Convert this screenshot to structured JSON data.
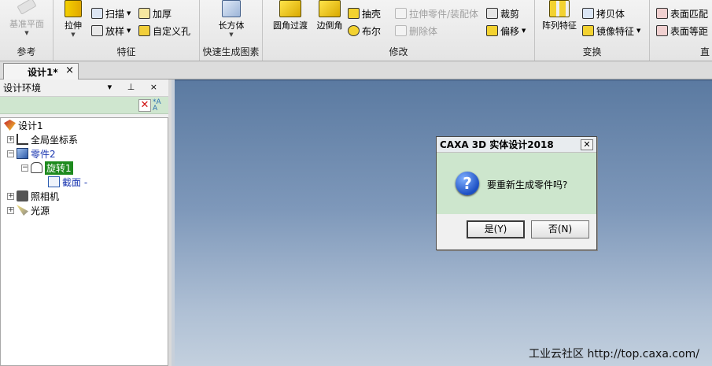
{
  "ribbon": {
    "groups": {
      "reference": "参考",
      "feature": "特征",
      "quick_gen": "快速生成图素",
      "modify": "修改",
      "transform": "变换",
      "cut_off": "直"
    },
    "buttons": {
      "reference_plane": "基准平面",
      "extrude": "拉伸",
      "sweep": "扫描",
      "loft": "放样",
      "thicken": "加厚",
      "custom_hole": "自定义孔",
      "box": "长方体",
      "fillet": "圆角过渡",
      "chamfer": "边倒角",
      "shell": "抽壳",
      "boolean": "布尔",
      "stretch_part": "拉伸零件/装配体",
      "delete_body": "删除体",
      "trim": "裁剪",
      "offset": "偏移",
      "array": "阵列特征",
      "copy": "拷贝体",
      "mirror": "镜像特征",
      "surface_match": "表面匹配",
      "surface_equal": "表面等距"
    }
  },
  "tabs": {
    "document": "设计1*",
    "close": "×"
  },
  "panel": {
    "title": "设计环境",
    "header_buttons": "▾ ⊥ ×",
    "tree": {
      "root": "设计1",
      "global_coords": "全局坐标系",
      "part": "零件2",
      "revolve": "旋转1",
      "section": "截面 -",
      "camera": "照相机",
      "light": "光源"
    }
  },
  "dialog": {
    "title": "CAXA 3D 实体设计2018",
    "message": "要重新生成零件吗?",
    "yes": "是(Y)",
    "no": "否(N)"
  },
  "viewport": {
    "watermark": "工业云社区 http://top.caxa.com/"
  },
  "colors": {
    "viewport_top": "#5b7aa1",
    "viewport_bottom": "#c3d0de",
    "panel_toolbar": "#cfe6cf",
    "selection": "#1e8a1e",
    "dialog_body": "#cde6cd"
  }
}
